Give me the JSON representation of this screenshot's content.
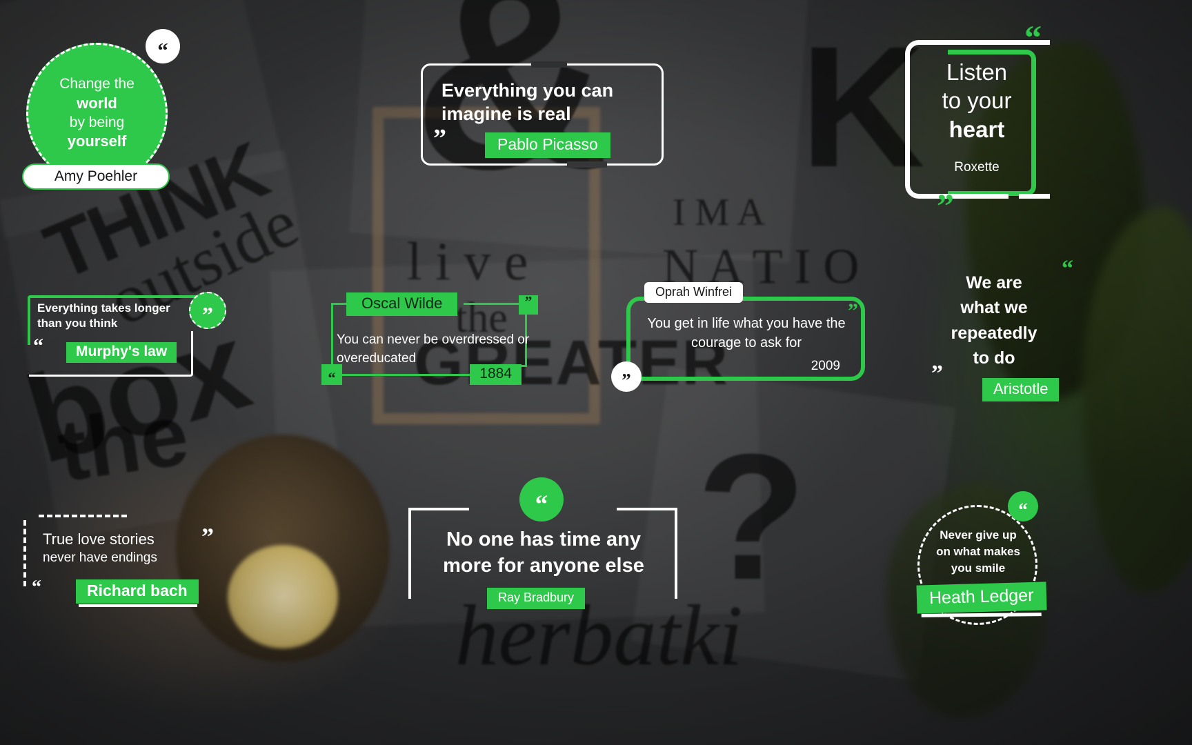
{
  "theme": {
    "accent_green": "#2ec84a",
    "white": "#ffffff",
    "background_dark": "#2f3032"
  },
  "quotes": [
    {
      "id": "amy-poehler",
      "line1": "Change the",
      "line2": "world",
      "line3": "by being",
      "line4": "yourself",
      "author": "Amy Poehler",
      "quote_icon": "“"
    },
    {
      "id": "pablo-picasso",
      "text": "Everything you can imagine is real",
      "author": "Pablo Picasso",
      "quote_icon_open": "“",
      "quote_icon_close": "”"
    },
    {
      "id": "roxette",
      "line1": "Listen",
      "line2": "to your",
      "line3": "heart",
      "author": "Roxette",
      "quote_icon_open": "“",
      "quote_icon_close": "”"
    },
    {
      "id": "murphys-law",
      "text": "Everything takes longer than you think",
      "author": "Murphy's law",
      "quote_icon_badge": "”",
      "quote_icon_open": "“"
    },
    {
      "id": "oscal-wilde",
      "name": "Oscal Wilde",
      "text": "You can never be overdressed or overeducated",
      "year": "1884",
      "quote_icon_open": "“",
      "quote_icon_close": "”"
    },
    {
      "id": "oprah-winfrei",
      "name": "Oprah Winfrei",
      "text": "You get in life what you have the courage to ask for",
      "year": "2009",
      "quote_icon_open": "”",
      "quote_icon_close": "”"
    },
    {
      "id": "aristotle",
      "line1": "We are",
      "line2": "what we",
      "line3": "repeatedly",
      "line4": "to do",
      "author": "Aristotle",
      "quote_icon_open": "“",
      "quote_icon_close": "”"
    },
    {
      "id": "richard-bach",
      "line1": "True love stories",
      "line2": "never have endings",
      "author": "Richard bach",
      "quote_icon_close": "”",
      "quote_icon_open": "“"
    },
    {
      "id": "ray-bradbury",
      "text": "No one has time any more for anyone else",
      "author": "Ray Bradbury",
      "quote_icon": "“"
    },
    {
      "id": "heath-ledger",
      "line1": "Never give up",
      "line2": "on what makes",
      "line3": "you smile",
      "author": "Heath Ledger",
      "quote_icon": "“"
    }
  ],
  "background_text": {
    "ampersand": "&",
    "think": "THINK",
    "outside": "outside",
    "box": "box",
    "the": "the",
    "live": "l i v e",
    "the2": "the",
    "greater": "GREATER",
    "im_a": "I M   A",
    "natio": "N A T I O",
    "question": "?",
    "herbatki": "herbatki",
    "k": "K"
  }
}
